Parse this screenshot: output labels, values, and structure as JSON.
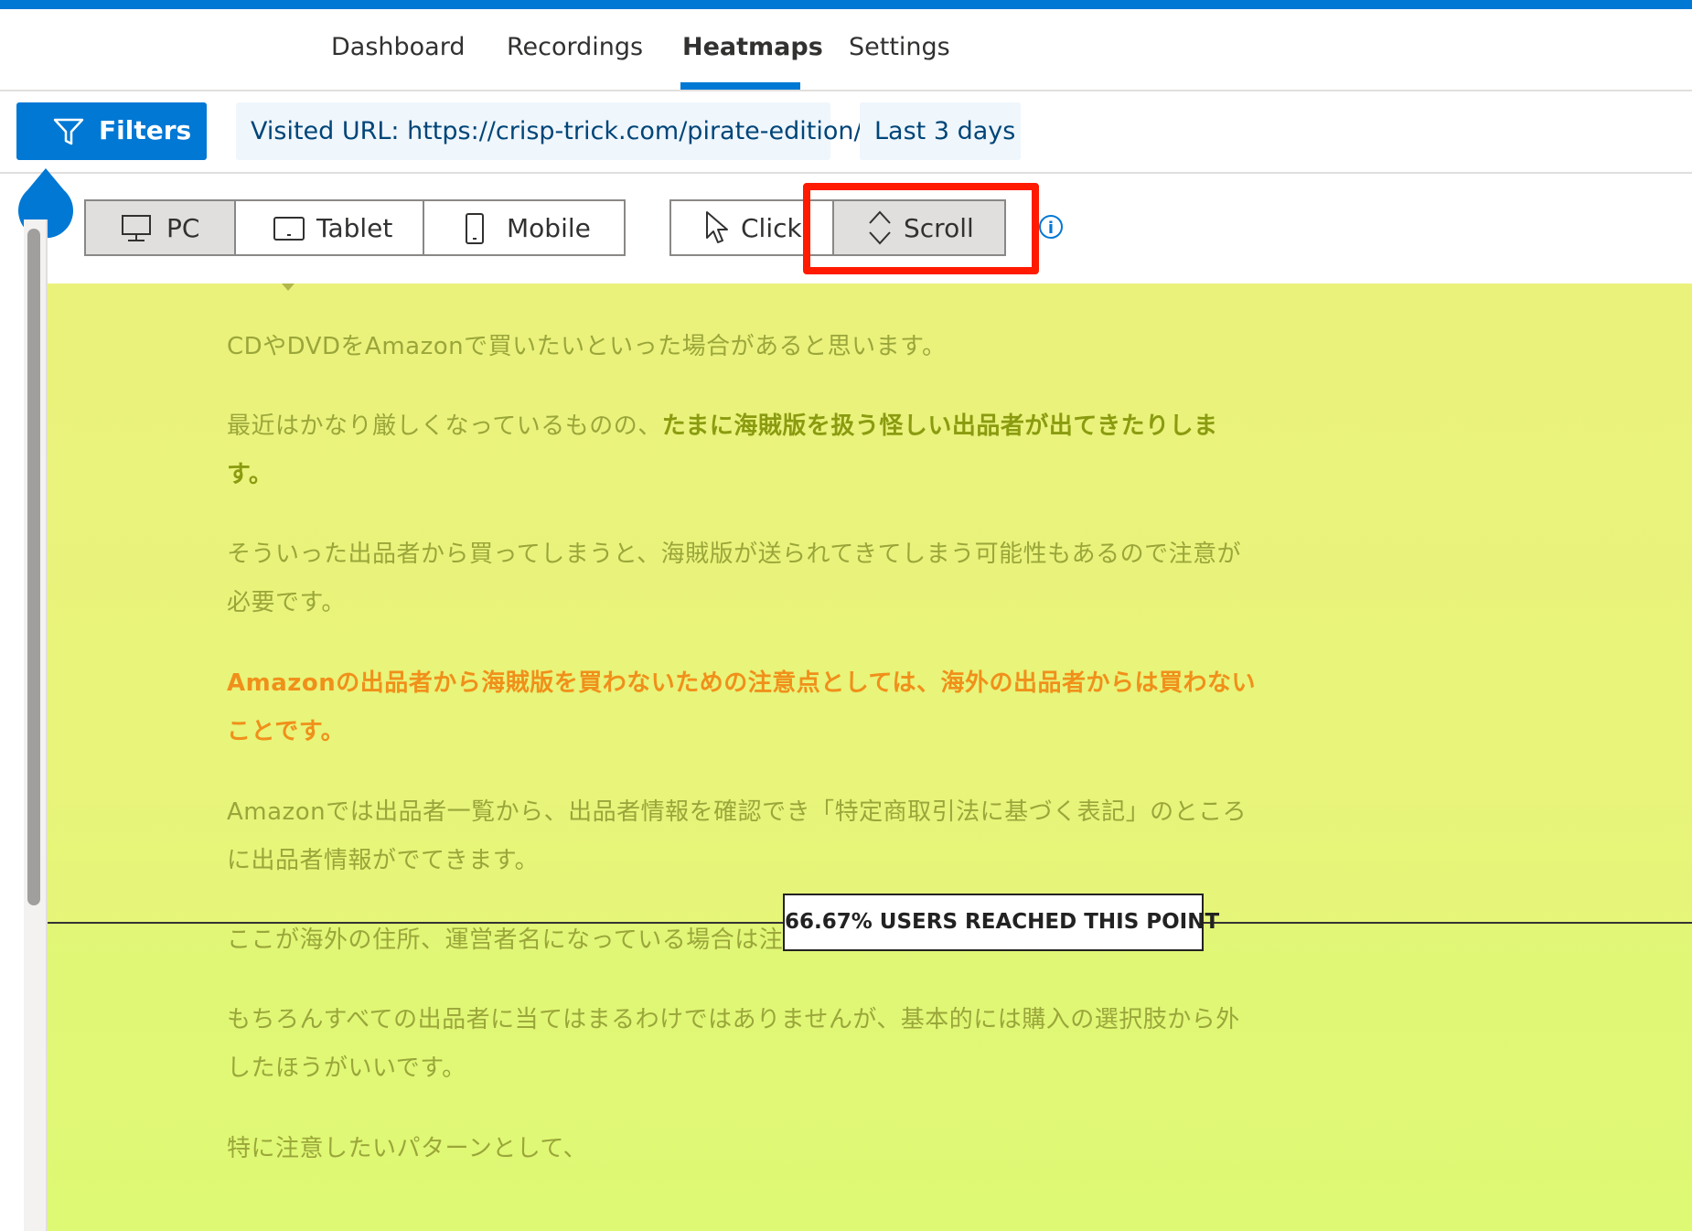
{
  "nav": {
    "tabs": [
      {
        "label": "Dashboard",
        "active": false
      },
      {
        "label": "Recordings",
        "active": false
      },
      {
        "label": "Heatmaps",
        "active": true
      },
      {
        "label": "Settings",
        "active": false
      }
    ]
  },
  "filterbar": {
    "filters_label": "Filters",
    "url_chip": "Visited URL: https://crisp-trick.com/pirate-edition/",
    "date_chip": "Last 3 days"
  },
  "toolbar": {
    "devices": [
      {
        "label": "PC",
        "icon": "desktop-icon",
        "active": true
      },
      {
        "label": "Tablet",
        "icon": "tablet-icon",
        "active": false
      },
      {
        "label": "Mobile",
        "icon": "mobile-icon",
        "active": false
      }
    ],
    "modes": [
      {
        "label": "Click",
        "icon": "cursor-icon",
        "active": false
      },
      {
        "label": "Scroll",
        "icon": "scroll-icon",
        "active": true
      }
    ],
    "info_icon": "i"
  },
  "heatmap": {
    "scroll_marker": "66.67% USERS REACHED THIS POINT",
    "paragraphs": {
      "p1": "CDやDVDをAmazonで買いたいといった場合があると思います。",
      "p2_normal": "最近はかなり厳しくなっているものの、",
      "p2_bold": "たまに海賊版を扱う怪しい出品者が出てきたりします。",
      "p3": "そういった出品者から買ってしまうと、海賊版が送られてきてしまう可能性もあるので注意が必要です。",
      "p4": "Amazonの出品者から海賊版を買わないための注意点としては、海外の出品者からは買わないことです。",
      "p5": "Amazonでは出品者一覧から、出品者情報を確認でき「特定商取引法に基づく表記」のところに出品者情報がでてきます。",
      "p6": "ここが海外の住所、運営者名になっている場合は注",
      "p7": "もちろんすべての出品者に当てはまるわけではありませんが、基本的には購入の選択肢から外したほうがいいです。",
      "p8": "特に注意したいパターンとして、"
    },
    "colors": {
      "heat_fill": "#e8f47a",
      "orange_text": "#f0901a",
      "accent": "#0078d4",
      "highlight": "#ff1a00"
    }
  }
}
